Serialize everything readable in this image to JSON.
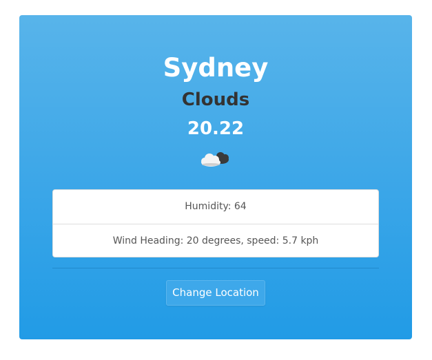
{
  "weather": {
    "city": "Sydney",
    "condition": "Clouds",
    "temperature": "20.22",
    "icon": "cloud-icon"
  },
  "details": {
    "humidity": "Humidity: 64",
    "wind": "Wind Heading: 20 degrees, speed: 5.7 kph"
  },
  "actions": {
    "change_location_label": "Change Location"
  },
  "colors": {
    "card_top": "#58b4ea",
    "card_bottom": "#219be6",
    "condition_text": "#333333"
  }
}
